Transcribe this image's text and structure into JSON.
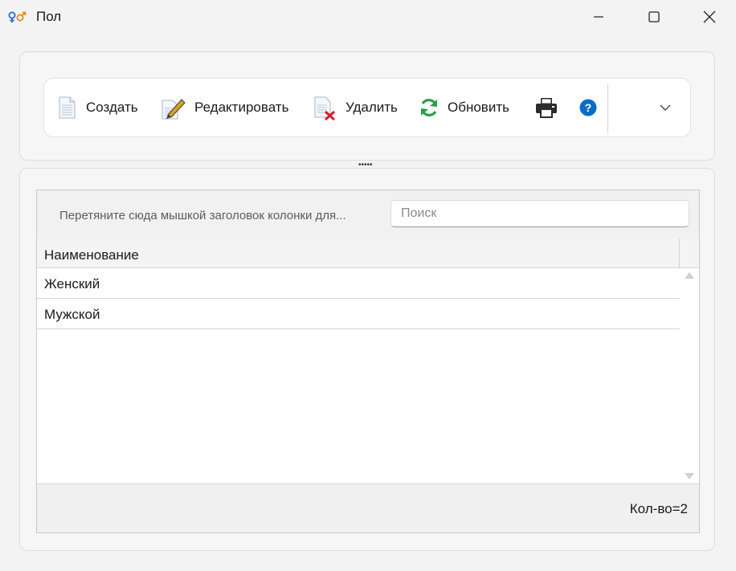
{
  "window": {
    "title": "Пол",
    "icon": "gender-icon"
  },
  "toolbar": {
    "items": [
      {
        "label": "Создать",
        "icon": "document-new-icon"
      },
      {
        "label": "Редактировать",
        "icon": "document-edit-icon"
      },
      {
        "label": "Удалить",
        "icon": "document-delete-icon"
      },
      {
        "label": "Обновить",
        "icon": "refresh-icon"
      }
    ],
    "print_icon": "printer-icon",
    "help_icon": "help-icon",
    "more_icon": "chevron-down-icon"
  },
  "grid": {
    "group_hint": "Перетяните сюда мышкой заголовок колонки для...",
    "search_placeholder": "Поиск",
    "search_value": "",
    "columns": [
      "Наименование"
    ],
    "rows": [
      [
        "Женский"
      ],
      [
        "Мужской"
      ]
    ],
    "footer_count": "Кол-во=2"
  },
  "colors": {
    "accent_blue": "#0a6cc9",
    "refresh_green": "#2e9b4a",
    "delete_red": "#d2202f"
  }
}
